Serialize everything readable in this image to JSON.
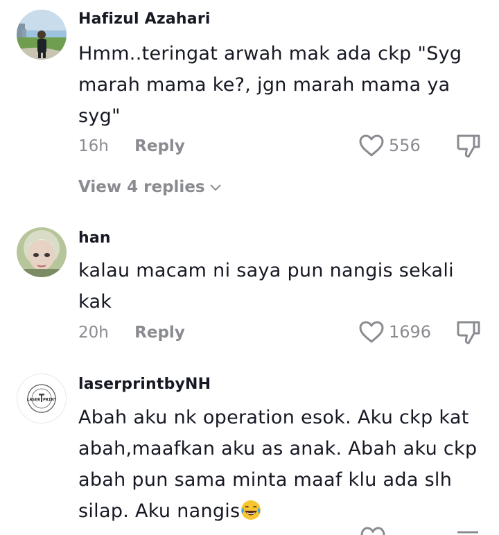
{
  "comments": [
    {
      "username": "Hafizul Azahari",
      "text": "Hmm..teringat arwah mak ada ckp \"Syg marah mama ke?, jgn marah mama ya syg\"",
      "time": "16h",
      "reply_label": "Reply",
      "likes": "556",
      "view_replies": "View 4 replies",
      "avatar": "avatar-photo-outdoor"
    },
    {
      "username": "han",
      "text": "kalau macam ni saya pun nangis sekali kak",
      "time": "20h",
      "reply_label": "Reply",
      "likes": "1696",
      "avatar": "avatar-photo-face"
    },
    {
      "username": "laserprintbyNH",
      "text": "Abah aku nk operation esok. Aku ckp kat abah,maafkan aku as anak. Abah aku ckp abah pun sama minta maaf klu ada slh silap. Aku nangis",
      "emoji": "face-with-tears-of-joy",
      "avatar": "laser-print-logo",
      "logo_text": "LASER PRINT"
    }
  ],
  "colors": {
    "text": "#161823",
    "muted": "#8a8b91"
  }
}
